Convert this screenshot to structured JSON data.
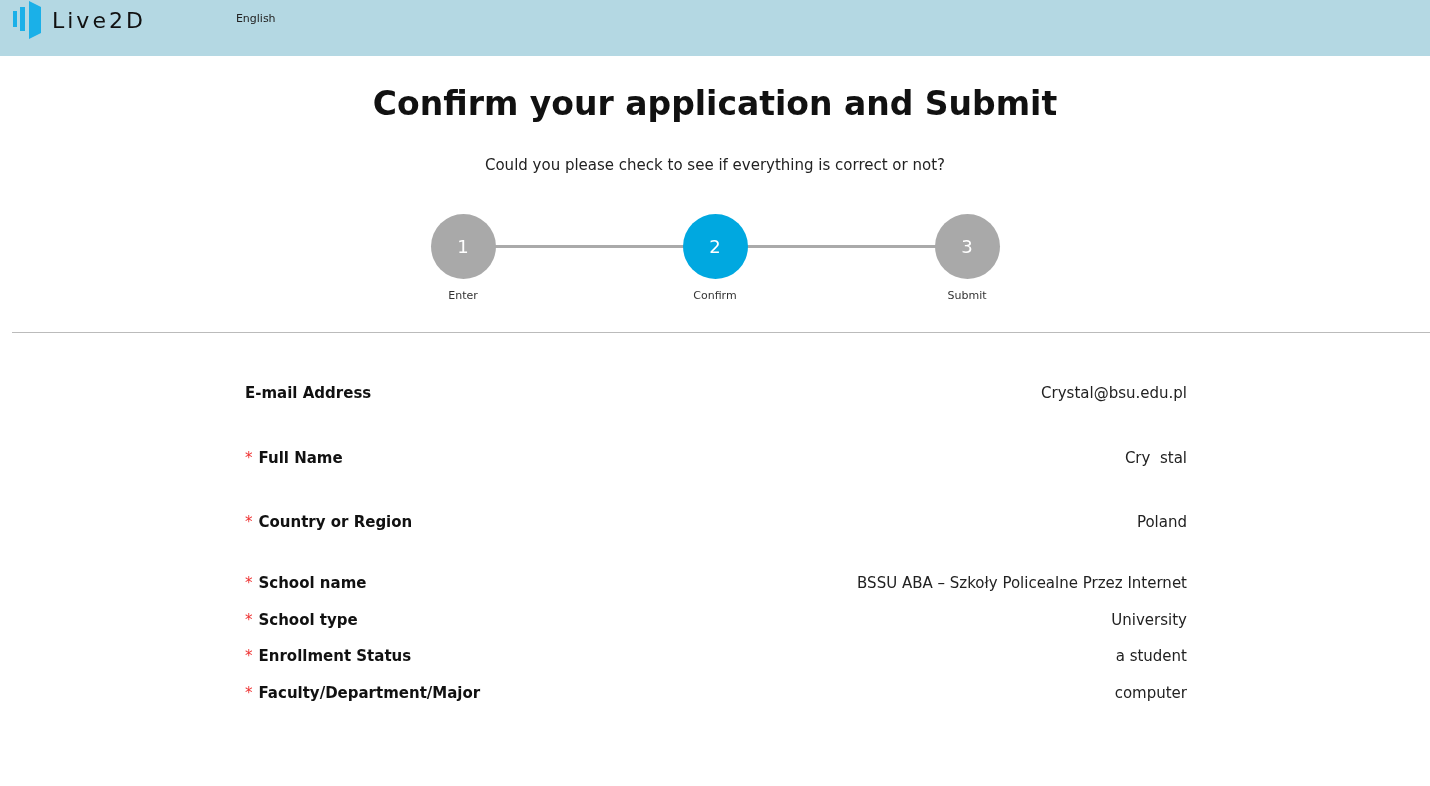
{
  "header": {
    "logo": "Live2D",
    "language": "English"
  },
  "title": "Confirm your application and Submit",
  "required_mark": "*",
  "subtitle": "Could you please check to see if everything is correct or not?",
  "steps": [
    {
      "number": "1",
      "label": "Enter",
      "selected": false
    },
    {
      "number": "2",
      "label": "Confirm",
      "selected": true
    },
    {
      "number": "3",
      "label": "Submit",
      "selected": false
    }
  ],
  "fields": [
    {
      "label": "E-mail Address",
      "value": "Crystal@bsu.edu.pl",
      "required": false,
      "kind": "spaced"
    },
    {
      "label": "Full Name",
      "value": "Cry  stal",
      "required": true,
      "kind": "spaced"
    },
    {
      "label": "Country or Region",
      "value": "Poland",
      "required": true,
      "kind": "spaced"
    },
    {
      "label": "School name",
      "value": "BSSU ABA – Szkoły Policealne Przez Internet",
      "required": true,
      "kind": "compact"
    },
    {
      "label": "School type",
      "value": "University",
      "required": true,
      "kind": "compact"
    },
    {
      "label": "Enrollment Status",
      "value": "a student",
      "required": true,
      "kind": "compact"
    },
    {
      "label": "Faculty/Department/Major",
      "value": "computer",
      "required": true,
      "kind": "compact"
    }
  ]
}
